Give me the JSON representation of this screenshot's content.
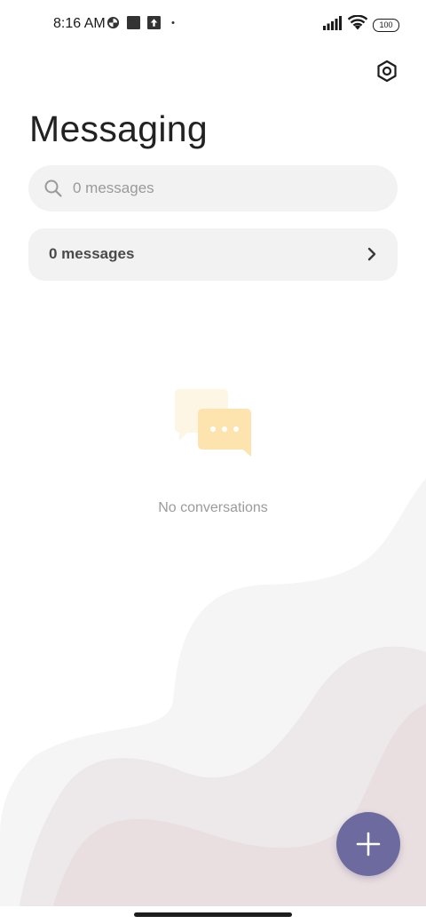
{
  "status_bar": {
    "time": "8:16 AM",
    "battery_level": "100",
    "icons": [
      "data-saver-icon",
      "square-notification-icon",
      "upload-notification-icon",
      "dot-icon",
      "signal-icon",
      "wifi-icon",
      "battery-icon"
    ]
  },
  "header": {
    "title": "Messaging",
    "settings_icon": "settings-hexagon-icon"
  },
  "search": {
    "placeholder": "0 messages",
    "icon": "search-icon"
  },
  "messages_card": {
    "label": "0 messages",
    "icon": "chevron-right-icon"
  },
  "empty_state": {
    "text": "No conversations",
    "illustration": "chat-bubbles-icon"
  },
  "fab": {
    "icon": "plus-icon"
  },
  "colors": {
    "accent": "#6d6aa0",
    "card_background": "#f2f2f2",
    "illustration": "#fde3ad"
  }
}
